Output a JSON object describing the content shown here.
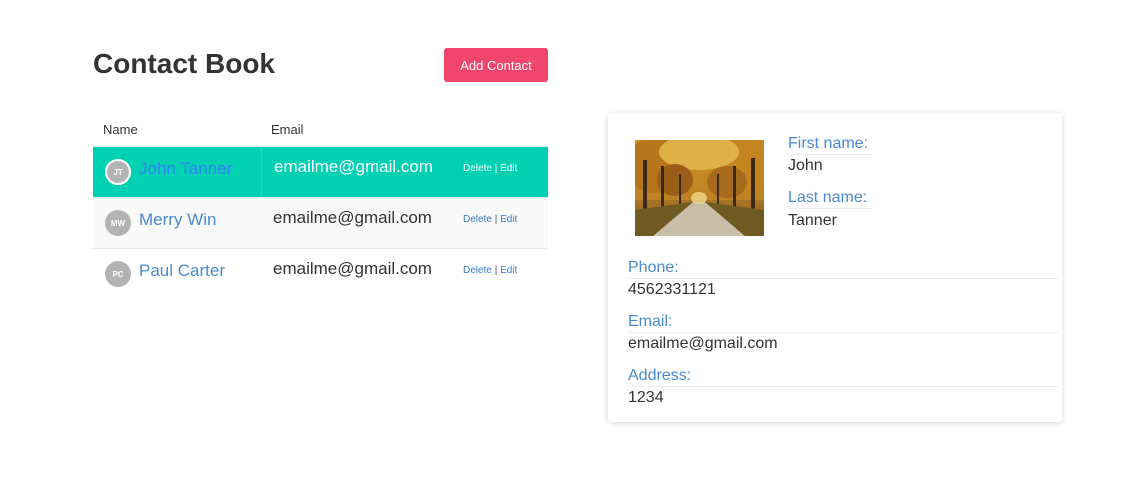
{
  "header": {
    "title": "Contact Book",
    "add_button_label": "Add Contact"
  },
  "table": {
    "columns": [
      "Name",
      "Email"
    ],
    "rows": [
      {
        "initials": "JT",
        "name": "John Tanner",
        "email": "emailme@gmail.com",
        "delete_label": "Delete",
        "edit_label": "Edit",
        "separator": "|"
      },
      {
        "initials": "MW",
        "name": "Merry Win",
        "email": "emailme@gmail.com",
        "delete_label": "Delete",
        "edit_label": "Edit",
        "separator": "|"
      },
      {
        "initials": "PC",
        "name": "Paul Carter",
        "email": "emailme@gmail.com",
        "delete_label": "Delete",
        "edit_label": "Edit",
        "separator": "|"
      }
    ],
    "selected_row": 0
  },
  "detail": {
    "first_name_label": "First name:",
    "first_name": "John",
    "last_name_label": "Last name:",
    "last_name": "Tanner",
    "phone_label": "Phone:",
    "phone": "4562331121",
    "email_label": "Email:",
    "email": "emailme@gmail.com",
    "address_label": "Address:",
    "address": "1234"
  },
  "colors": {
    "accent_button": "#f0466b",
    "selected_row": "#00d1b2",
    "link": "#4a8ad0"
  }
}
